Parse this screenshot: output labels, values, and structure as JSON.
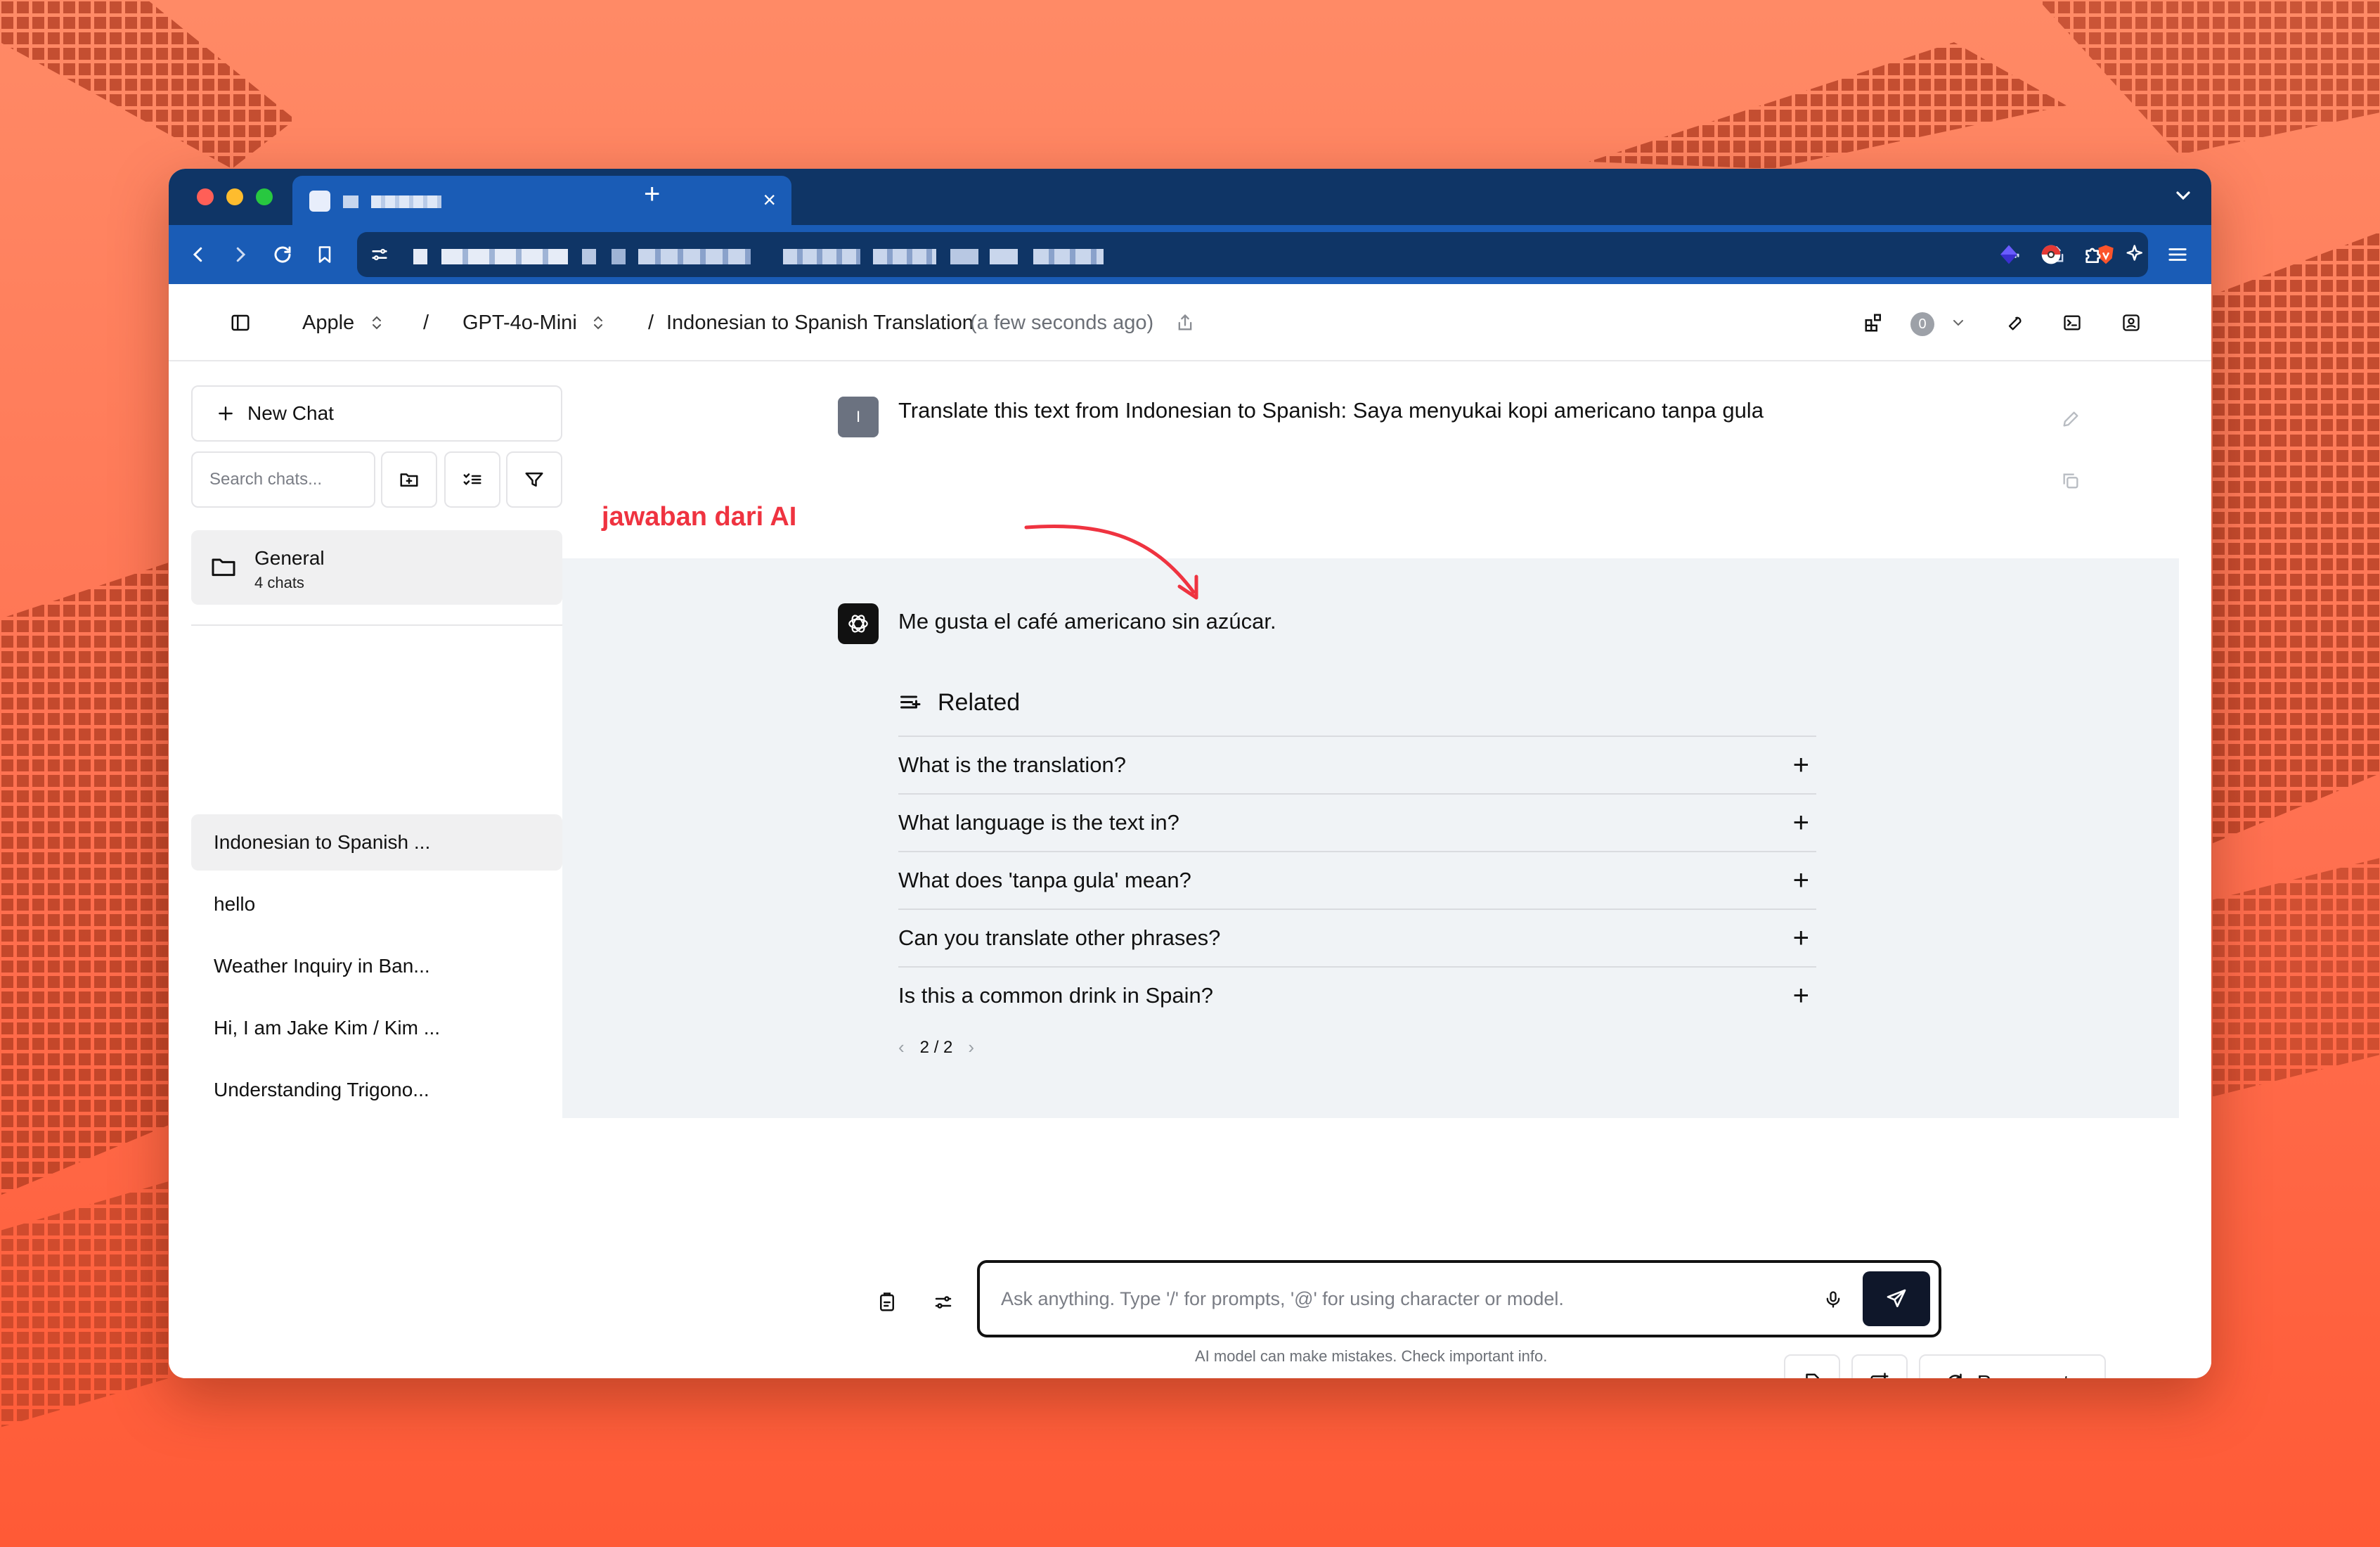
{
  "browser": {
    "tab_close": "×",
    "new_tab": "+"
  },
  "header": {
    "workspace": "Apple",
    "sep1": "/",
    "model": "GPT-4o-Mini",
    "sep2": "/",
    "chat_title": "Indonesian to Spanish Translation",
    "timestamp": "(a few seconds ago)",
    "badge_count": "0"
  },
  "sidebar": {
    "new_chat_label": "New Chat",
    "search_placeholder": "Search chats...",
    "folder": {
      "name": "General",
      "count": "4 chats"
    },
    "chats": [
      {
        "label": "Indonesian to Spanish ..."
      },
      {
        "label": "hello"
      },
      {
        "label": "Weather Inquiry in Ban..."
      },
      {
        "label": "Hi, I am Jake Kim / Kim ..."
      },
      {
        "label": "Understanding Trigono..."
      }
    ]
  },
  "conversation": {
    "user_avatar_initial": "I",
    "user_message": "Translate this text from Indonesian to Spanish: Saya menyukai kopi americano tanpa gula",
    "annotation": "jawaban dari AI",
    "ai_message": "Me gusta el café americano sin azúcar.",
    "related_title": "Related",
    "related": [
      {
        "q": "What is the translation?"
      },
      {
        "q": "What language is the text in?"
      },
      {
        "q": "What does 'tanpa gula' mean?"
      },
      {
        "q": "Can you translate other phrases?"
      },
      {
        "q": "Is this a common drink in Spain?"
      }
    ],
    "pager": "2 / 2"
  },
  "composer": {
    "regenerate_label": "Regenerate",
    "placeholder": "Ask anything.  Type '/' for prompts, '@' for using character or model.",
    "disclaimer": "AI model can make mistakes. Check important info."
  },
  "colors": {
    "accent": "#1a5cb6",
    "annotation": "#ef3340",
    "send_button": "#0f172a"
  }
}
